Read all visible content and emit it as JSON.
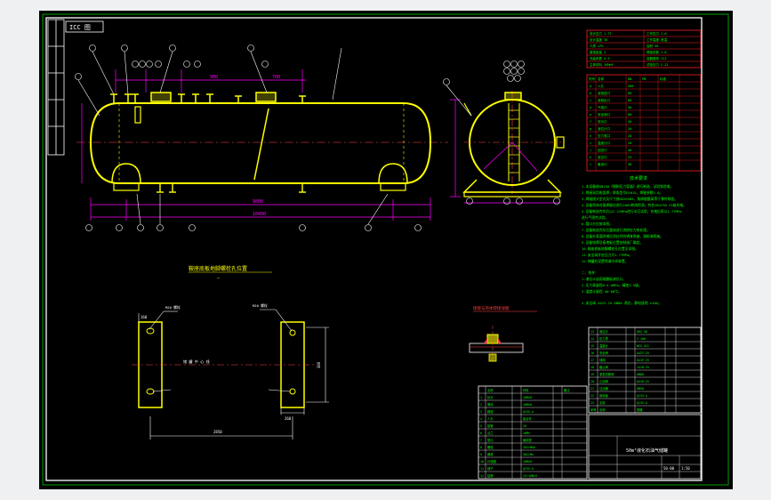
{
  "drawing": {
    "stamp_text": "ICC 图",
    "section_title": "鞍座底板地脚螺栓孔位置",
    "section_subtitle": "—",
    "weld_detail_title": "接管与壳体焊接详图",
    "plan_center_text": "储 罐 中 心 线",
    "plan_left_label": "M20 螺栓",
    "plan_right_label": "M20 螺栓",
    "plan_dims": [
      "2850",
      "380",
      "260",
      "160"
    ],
    "notes_title": "技术要求",
    "title_block": {
      "drawing_name": "50m³液化石油气储罐",
      "drawing_no": "50-00",
      "scale": "1:50"
    }
  },
  "colors": {
    "background": "#000000",
    "vessel": "#ffff00",
    "dimension": "#ff00ff",
    "text": "#00ff00",
    "border": "#ffffff",
    "table_red": "#ff2020",
    "frame_green": "#00c000"
  }
}
